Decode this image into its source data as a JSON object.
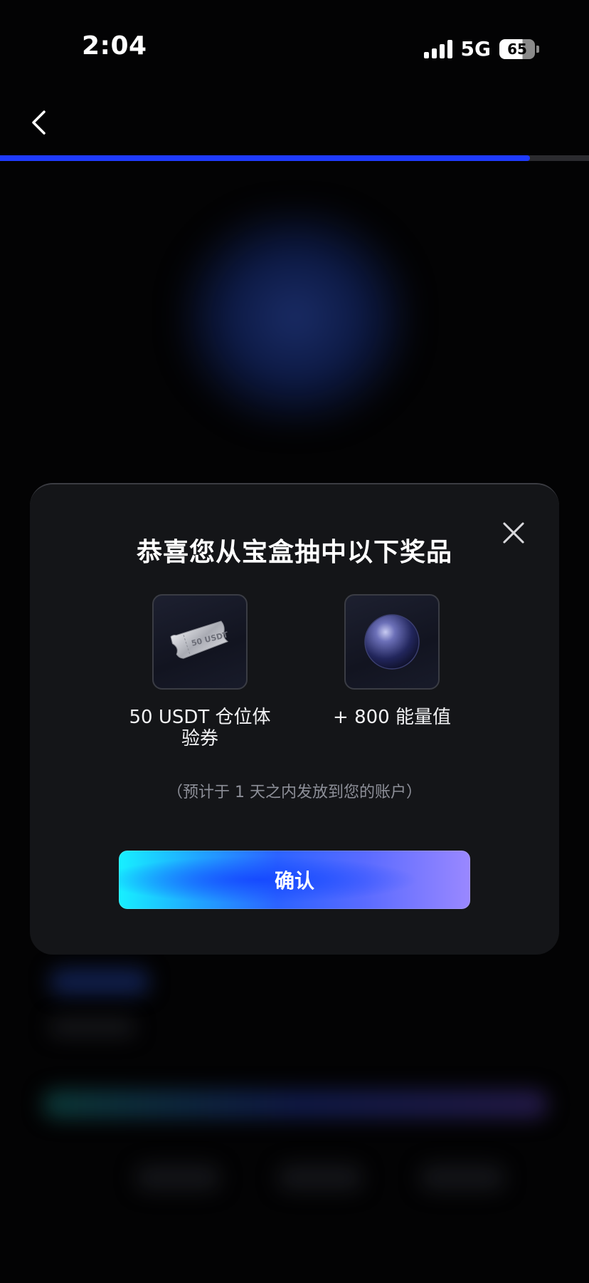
{
  "status_bar": {
    "time": "2:04",
    "network": "5G",
    "battery": "65"
  },
  "header": {
    "back_icon": "chevron-left-icon",
    "progress": 0.9
  },
  "modal": {
    "title": "恭喜您从宝盒抽中以下奖品",
    "close_icon": "close-icon",
    "prizes": [
      {
        "icon": "ticket-icon",
        "ticket_text": "50 USDT",
        "label": "50 USDT 仓位体验券"
      },
      {
        "icon": "energy-orb-icon",
        "label": "+ 800 能量值"
      }
    ],
    "note": "（预计于 1 天之内发放到您的账户）",
    "confirm_label": "确认"
  },
  "colors": {
    "progress": "#1f3bff",
    "modal_bg": "#141518",
    "button_start": "#17f0ff",
    "button_end": "#9a88ff"
  }
}
